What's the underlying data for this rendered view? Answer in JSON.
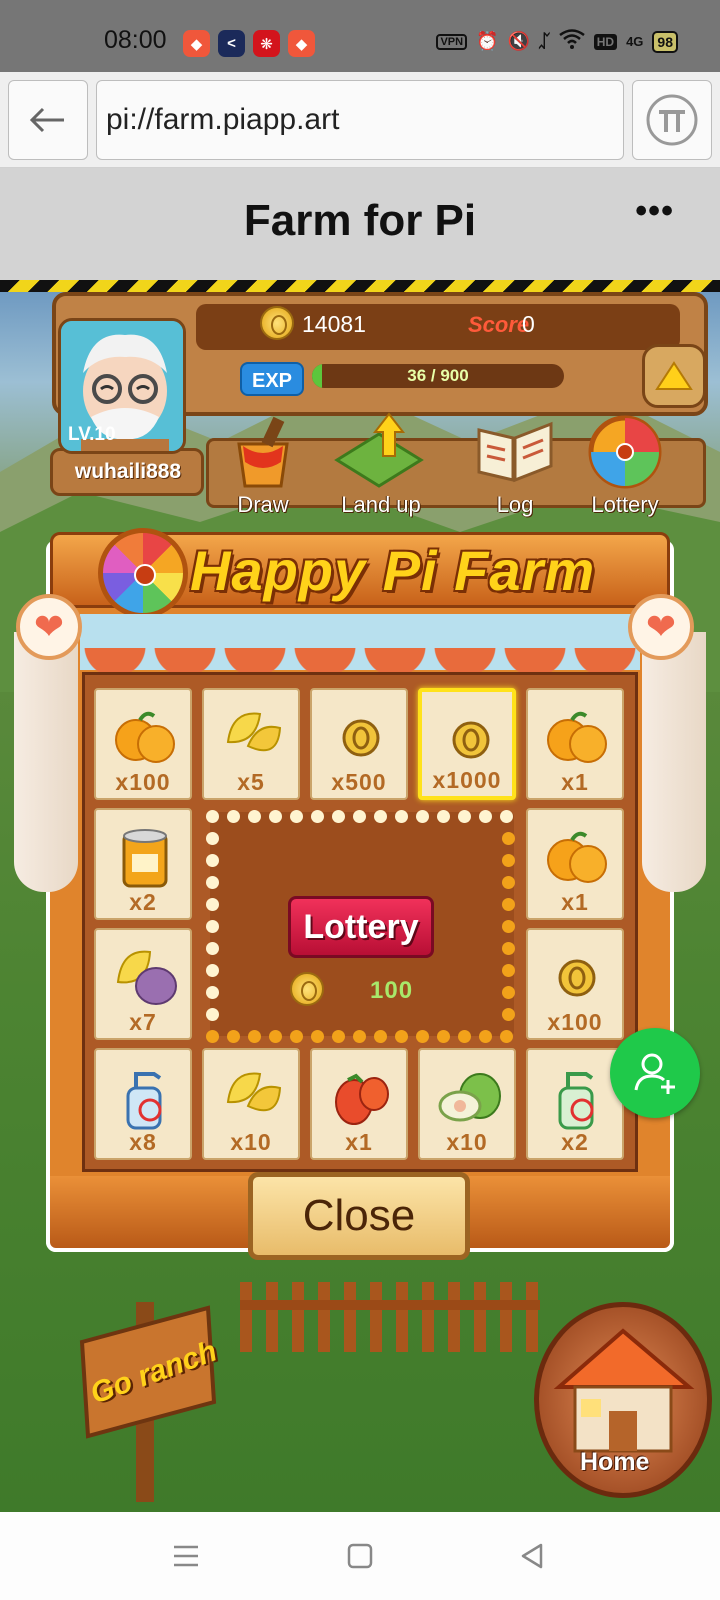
{
  "status_bar": {
    "time": "08:00",
    "notification_icons": [
      "kuaishou-icon",
      "dark-app-icon",
      "red-app-icon",
      "kuaishou-icon"
    ],
    "system_icons": [
      "vpn-icon",
      "alarm-icon",
      "mute-icon",
      "bluetooth-icon",
      "wifi-icon",
      "hd-icon",
      "signal-4g-icon"
    ],
    "vpn_label": "VPN",
    "hd_label": "HD",
    "network_label": "4G",
    "battery": "98"
  },
  "browser": {
    "url": "pi://farm.piapp.art"
  },
  "page": {
    "title": "Farm for Pi",
    "more_label": "•••"
  },
  "player": {
    "coins": "14081",
    "score_label": "Score",
    "score": "0",
    "exp_label": "EXP",
    "exp_text": "36 / 900",
    "exp_progress": 0.04,
    "level": "LV.10",
    "username": "wuhaili888"
  },
  "menu": {
    "items": [
      {
        "label": "Draw",
        "icon": "paint-bucket-icon"
      },
      {
        "label": "Land up",
        "icon": "land-up-icon"
      },
      {
        "label": "Log",
        "icon": "book-icon"
      },
      {
        "label": "Lottery",
        "icon": "prize-wheel-icon"
      }
    ]
  },
  "lottery": {
    "title": "Happy Pi Farm",
    "button_label": "Lottery",
    "close_label": "Close",
    "inner_value": "100",
    "tiles": [
      {
        "item": "orange",
        "qty": "x100"
      },
      {
        "item": "pomelo",
        "qty": "x5"
      },
      {
        "item": "coin",
        "qty": "x500"
      },
      {
        "item": "coin",
        "qty": "x1000",
        "selected": true
      },
      {
        "item": "orange",
        "qty": "x1"
      },
      {
        "item": "fertilizer-can",
        "qty": "x2"
      },
      {
        "item": "orange",
        "qty": "x1"
      },
      {
        "item": "pomelo-purple",
        "qty": "x7"
      },
      {
        "item": "coin",
        "qty": "x100"
      },
      {
        "item": "spray-bottle",
        "qty": "x8"
      },
      {
        "item": "pomelo",
        "qty": "x10"
      },
      {
        "item": "tomato",
        "qty": "x1"
      },
      {
        "item": "guava",
        "qty": "x10"
      },
      {
        "item": "spray-bottle-green",
        "qty": "x2"
      }
    ]
  },
  "scene": {
    "go_ranch_label": "Go ranch",
    "home_label": "Home"
  },
  "colors": {
    "accent_green": "#1fc94a",
    "board_orange": "#e0842c",
    "title_yellow": "#ffd21a",
    "lottery_red": "#d81e47"
  }
}
